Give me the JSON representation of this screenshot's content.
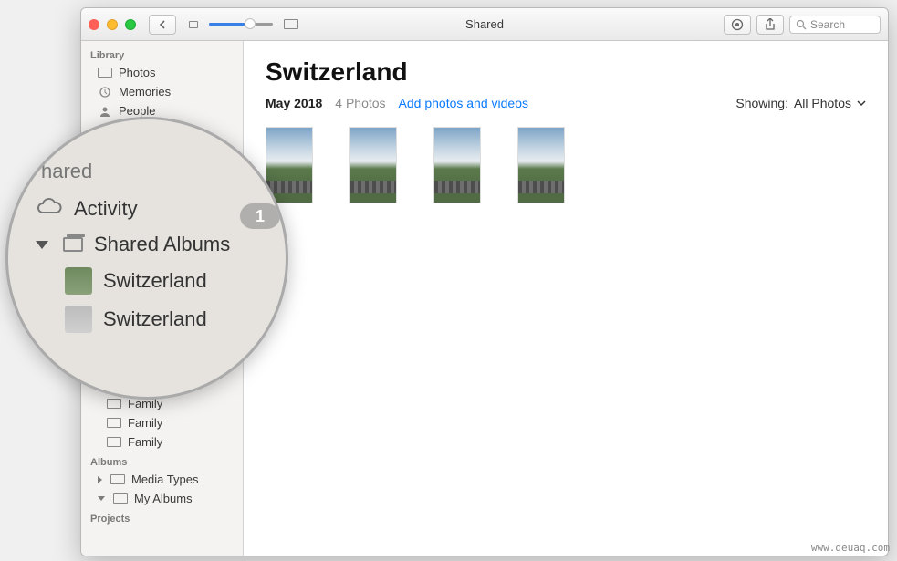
{
  "window": {
    "title": "Shared",
    "search_placeholder": "Search"
  },
  "sidebar": {
    "library_header": "Library",
    "library": [
      "Photos",
      "Memories",
      "People"
    ],
    "shared_header": "hared",
    "family_items": [
      "Family",
      "Family",
      "Family"
    ],
    "albums_header": "Albums",
    "albums": [
      "Media Types",
      "My Albums"
    ],
    "projects_header": "Projects"
  },
  "magnifier": {
    "section": "hared",
    "activity": "Activity",
    "badge": "1",
    "shared_albums": "Shared Albums",
    "items": [
      "Switzerland",
      "Switzerland"
    ]
  },
  "content": {
    "title": "Switzerland",
    "date": "May 2018",
    "count": "4 Photos",
    "add_link": "Add photos and videos",
    "showing_label": "Showing:",
    "showing_value": "All Photos"
  },
  "watermark": "www.deuaq.com"
}
